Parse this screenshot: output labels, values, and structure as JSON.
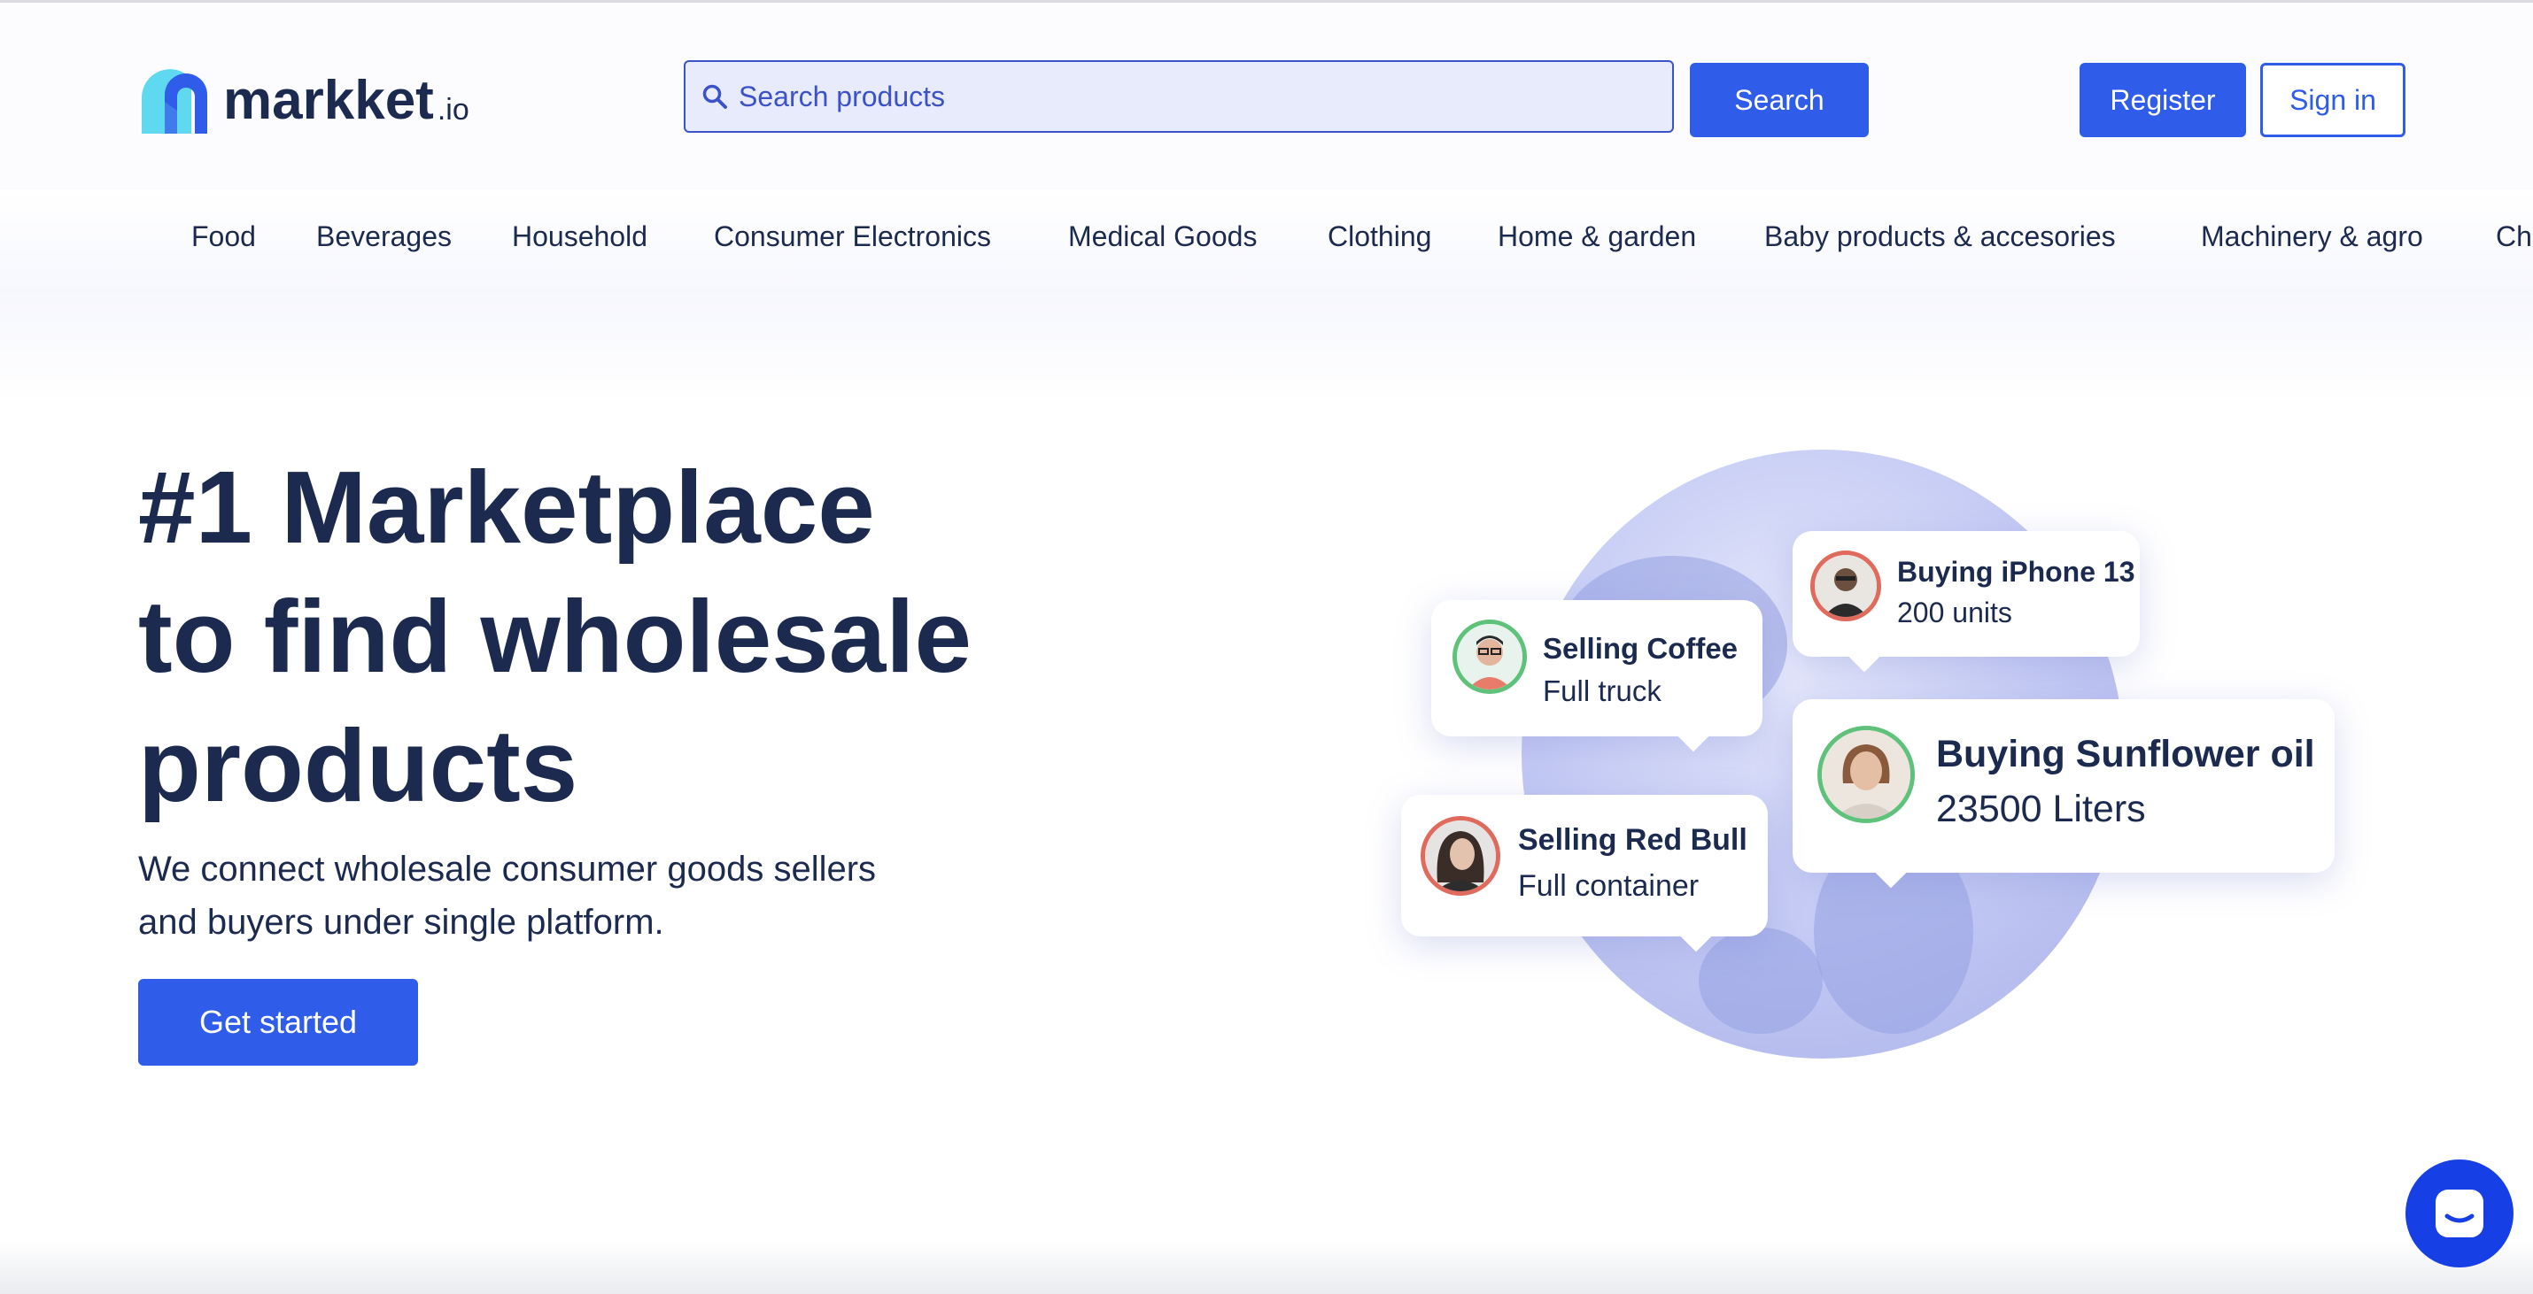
{
  "brand": {
    "name": "markket",
    "tld": ".io"
  },
  "search": {
    "placeholder": "Search products",
    "button": "Search"
  },
  "auth": {
    "register": "Register",
    "sign_in": "Sign in"
  },
  "categories": [
    "Food",
    "Beverages",
    "Household",
    "Consumer Electronics",
    "Medical Goods",
    "Clothing",
    "Home & garden",
    "Baby products & accesories",
    "Machinery & agro",
    "Ch"
  ],
  "hero": {
    "headline_lines": [
      "#1 Marketplace",
      "to find wholesale",
      "products"
    ],
    "subtext_lines": [
      "We connect wholesale consumer goods sellers",
      "and buyers under single platform."
    ],
    "cta": "Get started"
  },
  "bubbles": [
    {
      "title": "Buying iPhone 13",
      "subtitle": "200 units",
      "ring": "red"
    },
    {
      "title": "Selling Coffee",
      "subtitle": "Full truck",
      "ring": "green"
    },
    {
      "title": "Buying Sunflower oil",
      "subtitle": "23500 Liters",
      "ring": "green"
    },
    {
      "title": "Selling Red Bull",
      "subtitle": "Full container",
      "ring": "red"
    }
  ],
  "colors": {
    "primary": "#2f5ce9",
    "text": "#1b2a4e",
    "search_bg": "#e8ebfb",
    "ring_green": "#5ec27a",
    "ring_red": "#e06a5c",
    "chat_fab": "#1640e6"
  },
  "icons": {
    "search": "search-icon",
    "chat": "chat-icon",
    "logo": "logo-mark"
  }
}
